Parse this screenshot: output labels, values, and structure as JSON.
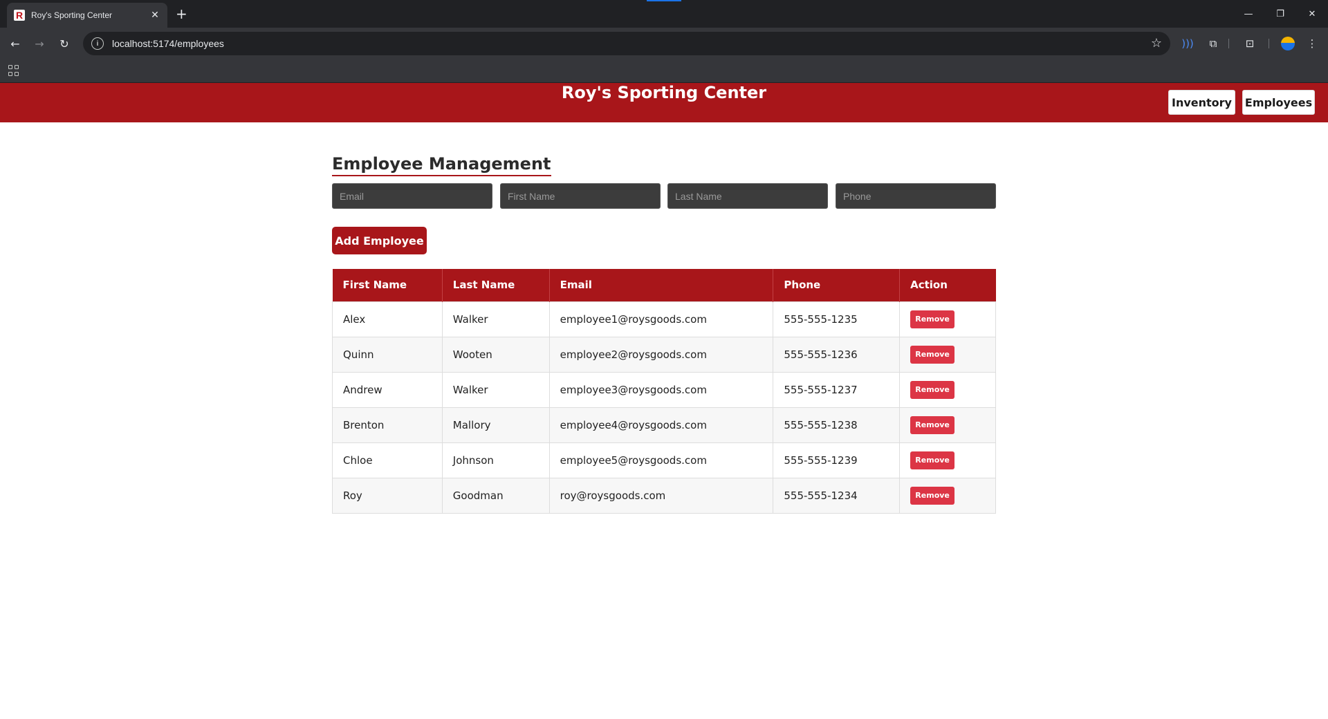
{
  "browser": {
    "tab_title": "Roy's Sporting Center",
    "favicon_letter": "R",
    "url_host": "localhost",
    "url_rest": ":5174/employees"
  },
  "header": {
    "title": "Roy's Sporting Center",
    "nav": [
      "Inventory",
      "Employees"
    ]
  },
  "main": {
    "title": "Employee Management",
    "fields": [
      {
        "placeholder": "Email",
        "value": ""
      },
      {
        "placeholder": "First Name",
        "value": ""
      },
      {
        "placeholder": "Last Name",
        "value": ""
      },
      {
        "placeholder": "Phone",
        "value": ""
      }
    ],
    "add_button": "Add Employee",
    "table": {
      "columns": [
        "First Name",
        "Last Name",
        "Email",
        "Phone",
        "Action"
      ],
      "rows": [
        {
          "first": "Alex",
          "last": "Walker",
          "email": "employee1@roysgoods.com",
          "phone": "555-555-1235",
          "action": "Remove"
        },
        {
          "first": "Quinn",
          "last": "Wooten",
          "email": "employee2@roysgoods.com",
          "phone": "555-555-1236",
          "action": "Remove"
        },
        {
          "first": "Andrew",
          "last": "Walker",
          "email": "employee3@roysgoods.com",
          "phone": "555-555-1237",
          "action": "Remove"
        },
        {
          "first": "Brenton",
          "last": "Mallory",
          "email": "employee4@roysgoods.com",
          "phone": "555-555-1238",
          "action": "Remove"
        },
        {
          "first": "Chloe",
          "last": "Johnson",
          "email": "employee5@roysgoods.com",
          "phone": "555-555-1239",
          "action": "Remove"
        },
        {
          "first": "Roy",
          "last": "Goodman",
          "email": "roy@roysgoods.com",
          "phone": "555-555-1234",
          "action": "Remove"
        }
      ]
    }
  },
  "colors": {
    "brand_red": "#a8161a",
    "remove_red": "#dc3545"
  }
}
